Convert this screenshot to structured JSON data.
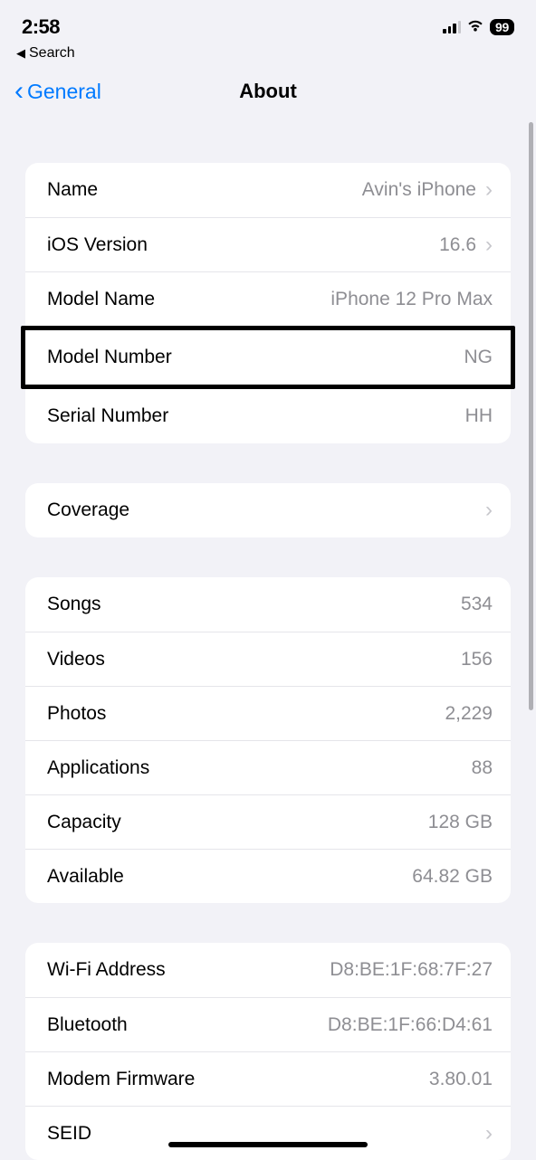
{
  "status": {
    "time": "2:58",
    "battery": "99"
  },
  "back_search": {
    "label": "Search"
  },
  "nav": {
    "back": "General",
    "title": "About"
  },
  "section1": [
    {
      "label": "Name",
      "value": "Avin's iPhone",
      "chevron": true
    },
    {
      "label": "iOS Version",
      "value": "16.6",
      "chevron": true
    },
    {
      "label": "Model Name",
      "value": "iPhone 12 Pro Max",
      "chevron": false
    },
    {
      "label": "Model Number",
      "value": "NG",
      "chevron": false
    },
    {
      "label": "Serial Number",
      "value": "HH",
      "chevron": false
    }
  ],
  "section2": [
    {
      "label": "Coverage",
      "value": "",
      "chevron": true
    }
  ],
  "section3": [
    {
      "label": "Songs",
      "value": "534"
    },
    {
      "label": "Videos",
      "value": "156"
    },
    {
      "label": "Photos",
      "value": "2,229"
    },
    {
      "label": "Applications",
      "value": "88"
    },
    {
      "label": "Capacity",
      "value": "128 GB"
    },
    {
      "label": "Available",
      "value": "64.82 GB"
    }
  ],
  "section4": [
    {
      "label": "Wi-Fi Address",
      "value": "D8:BE:1F:68:7F:27"
    },
    {
      "label": "Bluetooth",
      "value": "D8:BE:1F:66:D4:61"
    },
    {
      "label": "Modem Firmware",
      "value": "3.80.01"
    },
    {
      "label": "SEID",
      "value": "",
      "chevron": true
    }
  ]
}
